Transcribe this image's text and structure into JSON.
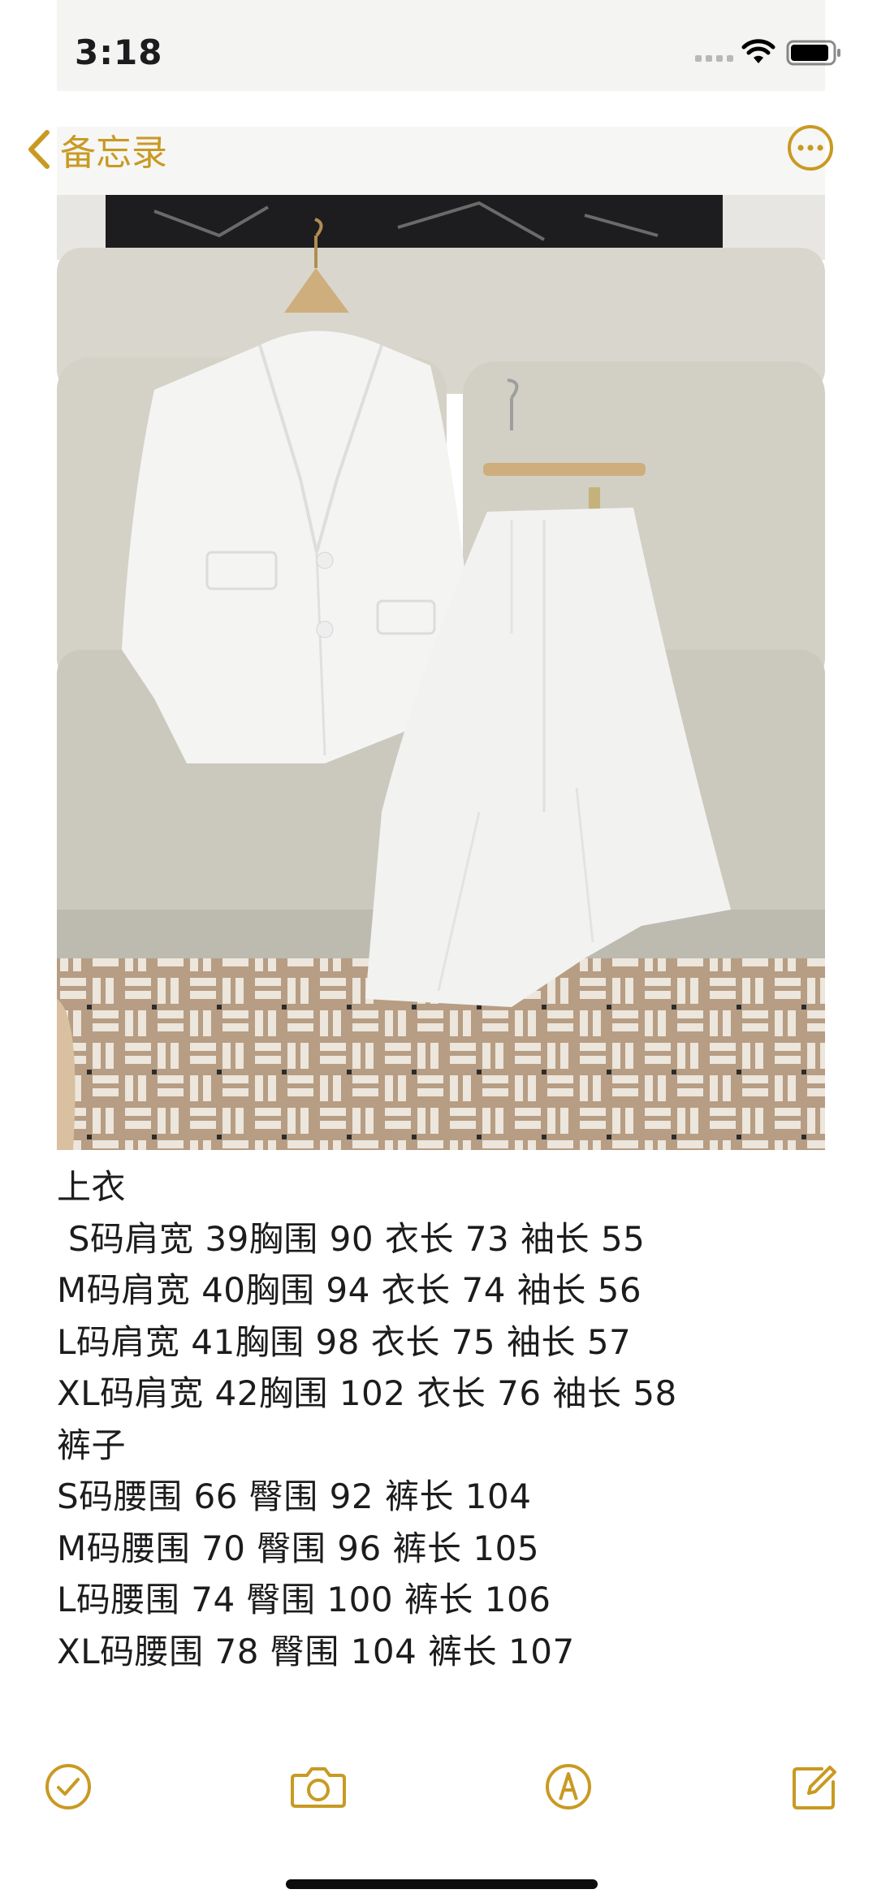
{
  "status_bar": {
    "time": "3:18",
    "signal_icon": "cellular-signal-icon",
    "wifi_icon": "wifi-icon",
    "battery_icon": "battery-icon"
  },
  "nav": {
    "back_label": "备忘录",
    "back_icon": "chevron-left-icon",
    "more_icon": "more-ellipsis-icon"
  },
  "note": {
    "image_alt": "photo of white linen blazer and trousers on a sofa",
    "lines": [
      "上衣",
      " S码肩宽 39胸围 90 衣长 73 袖长 55",
      "M码肩宽 40胸围 94 衣长 74 袖长 56",
      "L码肩宽 41胸围 98 衣长 75 袖长 57",
      "XL码肩宽 42胸围 102 衣长 76 袖长 58",
      "裤子",
      "S码腰围 66 臀围 92 裤长 104",
      "M码腰围 70 臀围 96 裤长 105",
      "L码腰围 74 臀围 100 裤长 106",
      "XL码腰围 78 臀围 104 裤长 107"
    ]
  },
  "toolbar": {
    "checklist_icon": "checklist-icon",
    "camera_icon": "camera-icon",
    "markup_icon": "markup-pen-icon",
    "compose_icon": "compose-icon"
  },
  "colors": {
    "accent": "#c99a22",
    "text": "#1c1c1e",
    "background": "#ffffff"
  }
}
